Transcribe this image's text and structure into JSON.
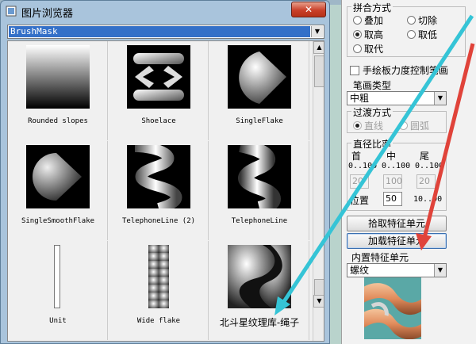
{
  "window": {
    "title": "图片浏览器",
    "close_label": "✕"
  },
  "browser": {
    "selected": "BrushMask",
    "items": [
      {
        "label": "Rounded slopes"
      },
      {
        "label": "Shoelace"
      },
      {
        "label": "SingleFlake"
      },
      {
        "label": "SingleSmoothFlake"
      },
      {
        "label": "TelephoneLine (2)"
      },
      {
        "label": "TelephoneLine"
      },
      {
        "label": "Unit"
      },
      {
        "label": "Wide flake"
      },
      {
        "label": "北斗星纹理库-绳子"
      }
    ]
  },
  "panel": {
    "blend": {
      "title": "拼合方式",
      "options": [
        "叠加",
        "切除",
        "取高",
        "取低",
        "取代"
      ],
      "selected": "取高"
    },
    "tablet_checkbox": "手绘板力度控制笔画",
    "stroke_type": {
      "title": "笔画类型",
      "value": "中粗"
    },
    "transition": {
      "title": "过渡方式",
      "options": [
        "直线",
        "圆弧"
      ],
      "selected": "直线"
    },
    "diameter": {
      "title": "直径比率",
      "headers": [
        "首",
        "中",
        "尾"
      ],
      "ranges": [
        "0..100",
        "0..100",
        "0..100"
      ],
      "values": [
        "20",
        "100",
        "20"
      ],
      "position_label": "位置",
      "position_value": "50",
      "position_range": "10..90"
    },
    "pick_button": "拾取特征单元",
    "load_button": "加载特征单元",
    "builtin": {
      "title": "内置特征单元",
      "value": "螺纹"
    }
  },
  "colors": {
    "arrow_cyan": "#35c4d6",
    "arrow_red": "#e0433a",
    "selection_blue": "#3470c8"
  }
}
